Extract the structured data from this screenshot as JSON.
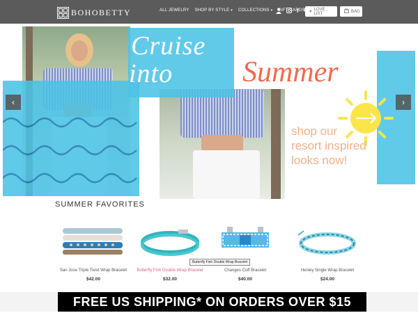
{
  "header": {
    "brand": "BOHOBETTY",
    "nav": [
      {
        "label": "ALL JEWELRY",
        "has_menu": false
      },
      {
        "label": "SHOP BY STYLE",
        "has_menu": true
      },
      {
        "label": "COLLECTIONS",
        "has_menu": true
      },
      {
        "label": "GIFT CARDS",
        "has_menu": false
      }
    ],
    "icons": [
      "user-icon",
      "instagram-icon",
      "facebook-icon",
      "search-icon"
    ],
    "love_list": "LOVE LIST",
    "bag": "BAG"
  },
  "hero": {
    "line1": "Cruise",
    "line2a": "into",
    "line2b": "Summer",
    "tagline": "shop our resort inspired looks now!",
    "colors": {
      "blue": "#4bc3e6",
      "coral": "#ef6b4e",
      "peach": "#f2b08b",
      "sun": "#fbe54a"
    }
  },
  "favorites": {
    "title": "SUMMER FAVORITES",
    "tooltip": "Butterfly Fish Double Wrap Bracelet",
    "products": [
      {
        "name": "San Jose Triple Twist Wrap Bracelet",
        "price": "$42.00"
      },
      {
        "name": "Butterfly Fish Double Wrap Bracelet",
        "price": "$32.00"
      },
      {
        "name": "Changes Cuff Bracelet",
        "price": "$40.00"
      },
      {
        "name": "Henley Single Wrap Bracelet",
        "price": "$24.00"
      }
    ]
  },
  "promo": {
    "text": "FREE US SHIPPING* ON ORDERS OVER $15"
  }
}
